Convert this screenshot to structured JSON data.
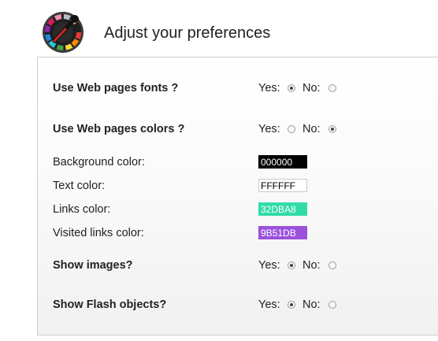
{
  "header": {
    "title": "Adjust your preferences",
    "icon": "color-wheel-icon"
  },
  "preferences": {
    "use_fonts": {
      "label": "Use Web pages fonts ?",
      "yes": "Yes:",
      "no": "No:",
      "selected": "yes"
    },
    "use_colors": {
      "label": "Use Web pages colors ?",
      "yes": "Yes:",
      "no": "No:",
      "selected": "no"
    },
    "background_color": {
      "label": "Background color:",
      "value": "000000",
      "bg": "#000000",
      "fg": "#ffffff"
    },
    "text_color": {
      "label": "Text color:",
      "value": "FFFFFF",
      "bg": "#FFFFFF",
      "fg": "#000000"
    },
    "links_color": {
      "label": "Links color:",
      "value": "32DBA8",
      "bg": "#32DBA8",
      "fg": "#ffffff"
    },
    "visited_links_color": {
      "label": "Visited links color:",
      "value": "9B51DB",
      "bg": "#9B51DB",
      "fg": "#ffffff"
    },
    "show_images": {
      "label": "Show images?",
      "yes": "Yes:",
      "no": "No:",
      "selected": "yes"
    },
    "show_flash": {
      "label": "Show Flash objects?",
      "yes": "Yes:",
      "no": "No:",
      "selected": "yes"
    }
  }
}
